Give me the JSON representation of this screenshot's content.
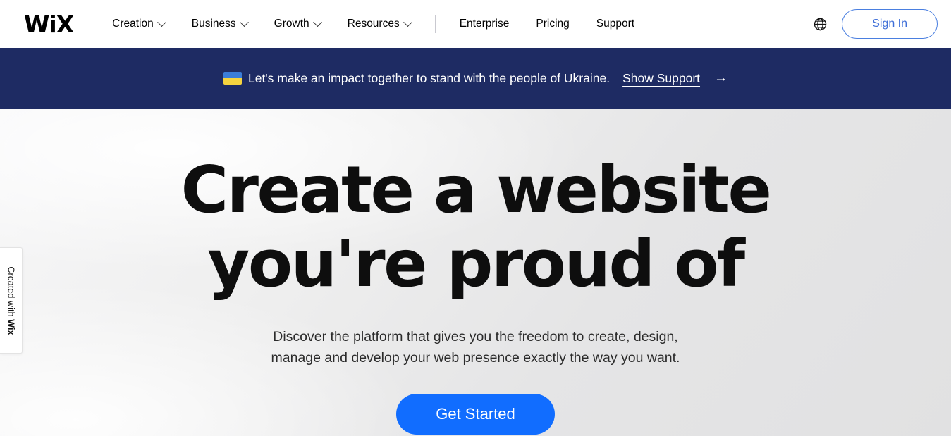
{
  "header": {
    "logo": "WiX",
    "nav_dropdowns": [
      {
        "label": "Creation",
        "icon": "chevron-down-icon"
      },
      {
        "label": "Business",
        "icon": "chevron-down-icon"
      },
      {
        "label": "Growth",
        "icon": "chevron-down-icon"
      },
      {
        "label": "Resources",
        "icon": "chevron-down-icon"
      }
    ],
    "nav_links": [
      {
        "label": "Enterprise"
      },
      {
        "label": "Pricing"
      },
      {
        "label": "Support"
      }
    ],
    "language_icon": "globe-icon",
    "signin_label": "Sign In",
    "signin_color": "#3f6fd8"
  },
  "banner": {
    "flag_icon": "ukraine-flag-icon",
    "text": "Let's make an impact together to stand with the people of Ukraine.",
    "link_label": "Show Support",
    "arrow_icon": "arrow-right-icon",
    "background_color": "#1e2b63",
    "text_color": "#ffffff"
  },
  "hero": {
    "title_line1": "Create a website",
    "title_line2": "you're proud of",
    "subtitle_line1": "Discover the platform that gives you the freedom to create, design,",
    "subtitle_line2": "manage and develop your web presence exactly the way you want.",
    "cta_label": "Get Started",
    "cta_color": "#116dff",
    "background_color": "#e5e5e6"
  },
  "side_tab": {
    "prefix": "Created with ",
    "brand": "Wix"
  }
}
